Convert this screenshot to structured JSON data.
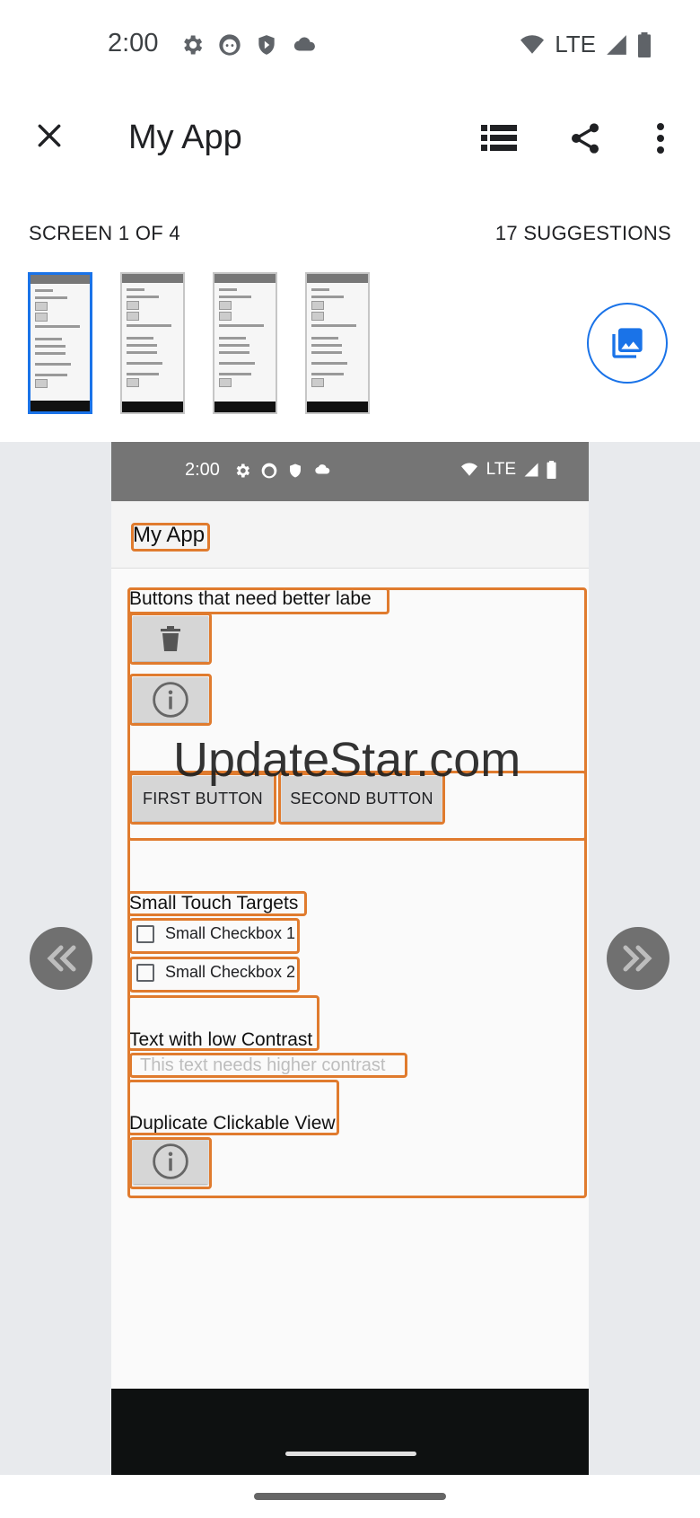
{
  "status_bar": {
    "time": "2:00",
    "network": "LTE"
  },
  "app_bar": {
    "title": "My App"
  },
  "screen_info": {
    "screen_label": "SCREEN 1 OF 4",
    "suggestions_label": "17 SUGGESTIONS"
  },
  "preview": {
    "status_time": "2:00",
    "status_network": "LTE",
    "app_title": "My App",
    "section_buttons_label": "Buttons that need better labels",
    "first_button": "FIRST BUTTON",
    "second_button": "SECOND BUTTON",
    "section_touch_label": "Small Touch Targets",
    "checkbox_1": "Small Checkbox 1",
    "checkbox_2": "Small Checkbox 2",
    "section_contrast_label": "Text with low Contrast",
    "low_contrast_text": "This text needs higher contrast",
    "section_duplicate_label": "Duplicate Clickable View"
  },
  "watermark": "UpdateStar.com",
  "colors": {
    "accent": "#1a73e8",
    "highlight": "#e07b2e",
    "preview_status": "#757575"
  }
}
